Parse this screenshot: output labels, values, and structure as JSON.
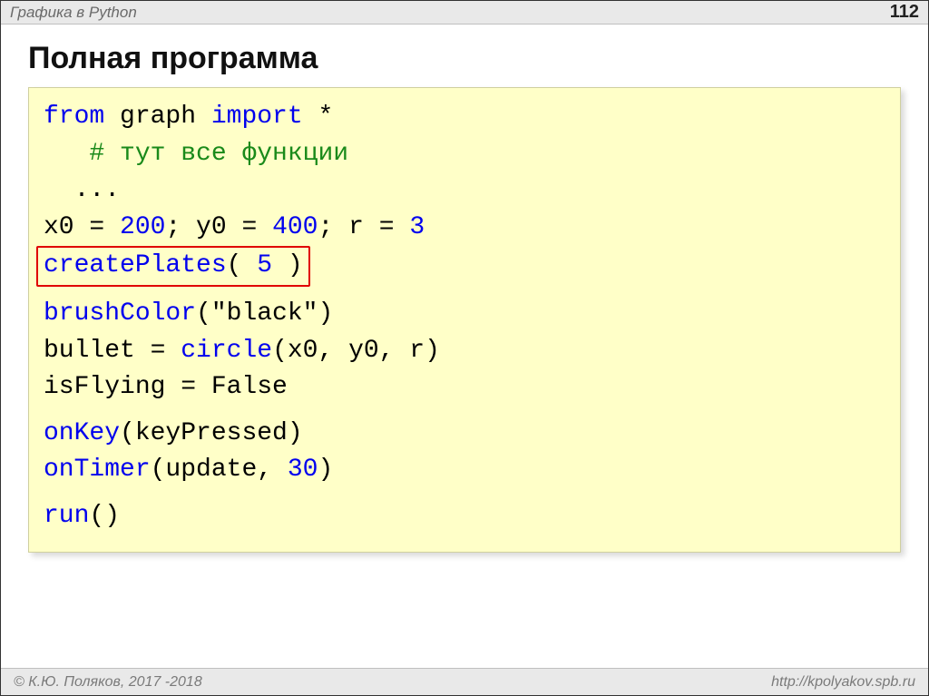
{
  "header": {
    "breadcrumb": "Графика в Python",
    "page_number": "112"
  },
  "title": "Полная программа",
  "code": {
    "l1_kw1": "from",
    "l1_txt1": " graph ",
    "l1_kw2": "import",
    "l1_txt2": " *",
    "l2_indent": "   ",
    "l2_cmt": "# тут все функции",
    "l3_indent": "  ",
    "l3_ell": "...",
    "l4_a": "x0 = ",
    "l4_n1": "200",
    "l4_b": "; y0 = ",
    "l4_n2": "400",
    "l4_c": "; r = ",
    "l4_n3": "3",
    "l5_fn": "createPlates",
    "l5_a": "( ",
    "l5_n": "5",
    "l5_b": " )",
    "l6_fn": "brushColor",
    "l6_args": "(\"black\")",
    "l7_a": "bullet = ",
    "l7_fn": "circle",
    "l7_args": "(x0, y0, r)",
    "l8": "isFlying = False",
    "l9_fn": "onKey",
    "l9_args": "(keyPressed)",
    "l10_fn": "onTimer",
    "l10_a": "(update, ",
    "l10_n": "30",
    "l10_b": ")",
    "l11_fn": "run",
    "l11_args": "()"
  },
  "footer": {
    "copyright": "© К.Ю. Поляков, 2017 -2018",
    "url": "http://kpolyakov.spb.ru"
  }
}
